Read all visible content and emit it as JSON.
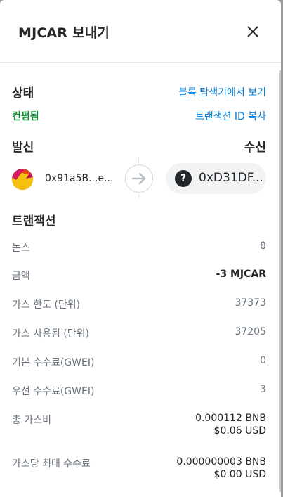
{
  "header": {
    "title": "MJCAR 보내기"
  },
  "status": {
    "label": "상태",
    "value": "컨펌됨",
    "explorer_link": "블록 탐색기에서 보기",
    "copy_tx_id": "트랜잭션 ID 복사"
  },
  "parties": {
    "from_label": "발신",
    "to_label": "수신",
    "from_address": "0x91a5B...e...",
    "to_address": "0xD31DF..."
  },
  "transaction": {
    "section_title": "트랜잭션",
    "rows": [
      {
        "label": "논스",
        "value": "8"
      },
      {
        "label": "금액",
        "value": "-3 MJCAR"
      },
      {
        "label": "가스 한도 (단위)",
        "value": "37373"
      },
      {
        "label": "가스 사용됨 (단위)",
        "value": "37205"
      },
      {
        "label": "기본 수수료(GWEI)",
        "value": "0"
      },
      {
        "label": "우선 수수료(GWEI)",
        "value": "3"
      },
      {
        "label": "총 가스비",
        "value": "0.000112 BNB",
        "sub": "$0.06 USD"
      },
      {
        "label": "가스당 최대 수수료",
        "value": "0.000000003 BNB",
        "sub": "$0.00 USD"
      }
    ]
  },
  "colors": {
    "link": "#037dd6",
    "confirmed": "#118d36",
    "text": "#24272a",
    "muted": "#6a737d"
  }
}
